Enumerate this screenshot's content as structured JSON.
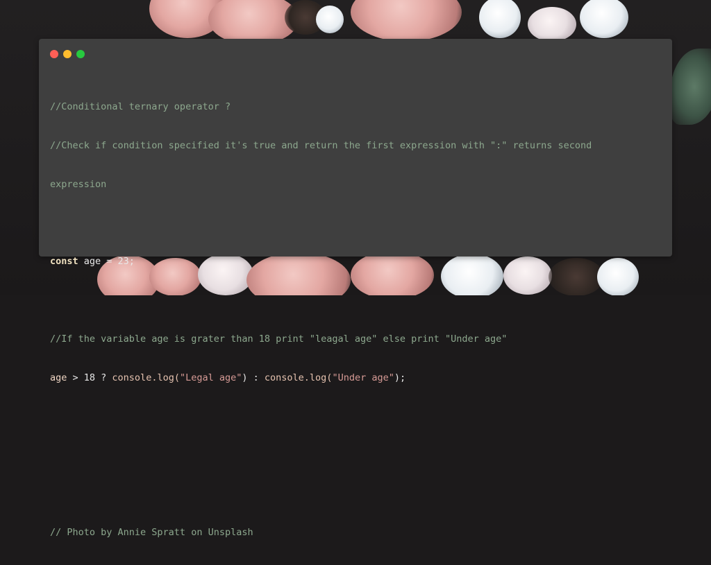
{
  "background": {
    "description_icon": "floral-photo-background"
  },
  "window": {
    "traffic_lights": [
      {
        "name": "close",
        "color": "#ff5f56"
      },
      {
        "name": "minimize",
        "color": "#ffbd2e"
      },
      {
        "name": "maximize",
        "color": "#27c93f"
      }
    ],
    "background_color": "#3f3f3f"
  },
  "code": {
    "comment_1": "//Conditional ternary operator ?",
    "comment_2": "//Check if condition specified it's true and return the first expression with \":\" returns second",
    "comment_2_wrap": "expression",
    "const_kw": "const",
    "const_rest": " age = 23;",
    "comment_3": "//If the variable age is grater than 18 print \"leagal age\" else print \"Under age\"",
    "ternary": {
      "var": "age",
      "cond": " > 18 ? ",
      "fn1": "console.log(",
      "str1": "\"Legal age\"",
      "mid": ") : ",
      "fn2": "console.log(",
      "str2": "\"Under age\"",
      "end": ");"
    },
    "credit": "// Photo by Annie Spratt on Unsplash"
  }
}
